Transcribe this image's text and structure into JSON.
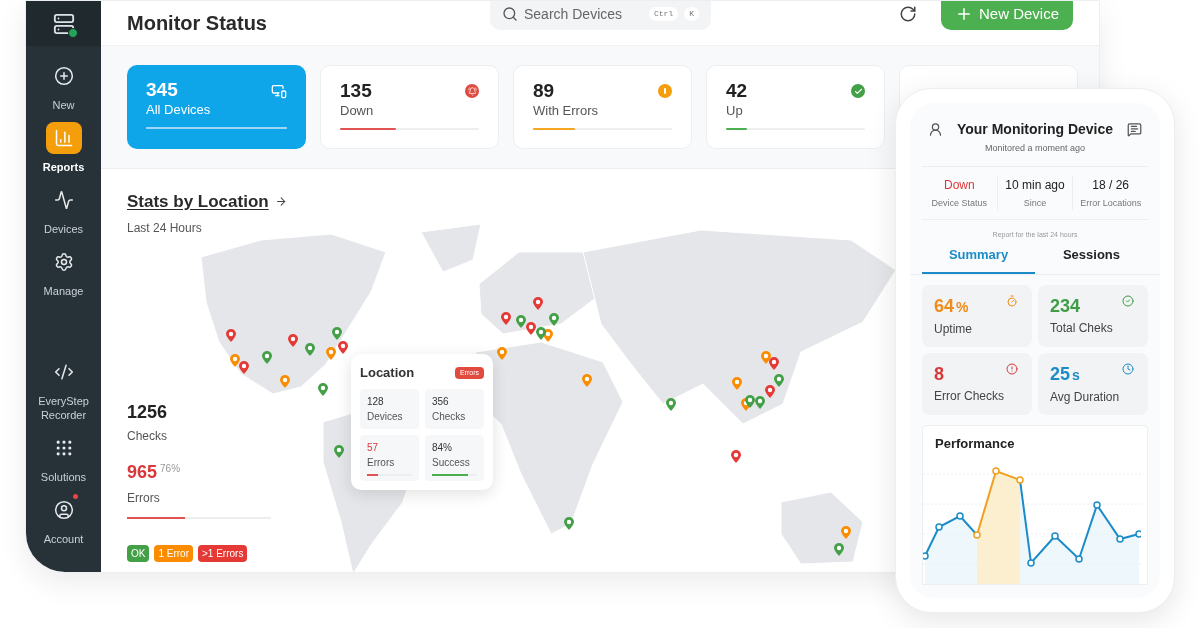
{
  "sidebar": {
    "items": [
      {
        "label": "New",
        "kind": "new",
        "selected": false,
        "notification": false
      },
      {
        "label": "Reports",
        "kind": "reports",
        "selected": true,
        "notification": false
      },
      {
        "label": "Devices",
        "kind": "devices",
        "selected": false,
        "notification": false
      },
      {
        "label": "Manage",
        "kind": "manage",
        "selected": false,
        "notification": false
      },
      {
        "label": "EveryStep Recorder",
        "kind": "recorder",
        "selected": false,
        "notification": false
      },
      {
        "label": "Solutions",
        "kind": "solutions",
        "selected": false,
        "notification": false
      },
      {
        "label": "Account",
        "kind": "account",
        "selected": false,
        "notification": true
      }
    ]
  },
  "header": {
    "title": "Monitor Status",
    "search": {
      "placeholder": "Search Devices",
      "shortcut": [
        "Ctrl",
        "K"
      ]
    },
    "new_button": "New Device"
  },
  "cards": [
    {
      "value": "345",
      "label": "All Devices",
      "kind": "all",
      "selected": true,
      "level": 1
    },
    {
      "value": "135",
      "label": "Down",
      "kind": "down",
      "selected": false,
      "level": 0.4
    },
    {
      "value": "89",
      "label": "With Errors",
      "kind": "errors",
      "selected": false,
      "level": 0.3
    },
    {
      "value": "42",
      "label": "Up",
      "kind": "up",
      "selected": false,
      "level": 0.15
    }
  ],
  "map": {
    "title": "Stats by Location",
    "subtitle": "Last 24 Hours",
    "checks": {
      "value": "1256",
      "label": "Checks"
    },
    "errors": {
      "value": "965",
      "percent": "76%",
      "label": "Errors",
      "level": 0.4
    },
    "legend": [
      {
        "label": "OK",
        "color": "#43a047"
      },
      {
        "label": "1 Error",
        "color": "#fb8c00"
      },
      {
        "label": ">1 Errors",
        "color": "#e53935"
      }
    ],
    "pins": [
      {
        "color": "#e53935"
      },
      {
        "color": "#fb8c00"
      },
      {
        "color": "#e53935"
      },
      {
        "color": "#43a047"
      },
      {
        "color": "#e53935"
      },
      {
        "color": "#43a047"
      },
      {
        "color": "#fb8c00"
      },
      {
        "color": "#43a047"
      },
      {
        "color": "#e53935"
      },
      {
        "color": "#fb8c00"
      },
      {
        "color": "#43a047"
      },
      {
        "color": "#43a047"
      },
      {
        "color": "#e53935"
      },
      {
        "color": "#e53935"
      },
      {
        "color": "#43a047"
      },
      {
        "color": "#e53935"
      },
      {
        "color": "#fb8c00"
      },
      {
        "color": "#43a047"
      },
      {
        "color": "#43a047"
      },
      {
        "color": "#fb8c00"
      },
      {
        "color": "#fb8c00"
      },
      {
        "color": "#43a047"
      },
      {
        "color": "#fb8c00"
      },
      {
        "color": "#e53935"
      },
      {
        "color": "#fb8c00"
      },
      {
        "color": "#43a047"
      },
      {
        "color": "#e53935"
      },
      {
        "color": "#fb8c00"
      },
      {
        "color": "#43a047"
      },
      {
        "color": "#43a047"
      },
      {
        "color": "#e53935"
      },
      {
        "color": "#43a047"
      },
      {
        "color": "#fb8c00"
      },
      {
        "color": "#43a047"
      }
    ],
    "popup": {
      "title": "Location",
      "badge": "Errors",
      "stats": [
        {
          "value": "128",
          "label": "Devices",
          "kind": "plain"
        },
        {
          "value": "356",
          "label": "Checks",
          "kind": "plain"
        },
        {
          "value": "57",
          "label": "Errors",
          "kind": "error",
          "level": 0.25
        },
        {
          "value": "84%",
          "label": "Success",
          "kind": "success",
          "level": 0.8
        }
      ]
    }
  },
  "phone": {
    "title": "Your Monitoring Device",
    "subtitle": "Monitored a moment ago",
    "status": [
      {
        "value": "Down",
        "label": "Device Status",
        "kind": "alert"
      },
      {
        "value": "10 min ago",
        "label": "Since",
        "kind": "plain"
      },
      {
        "value": "18 / 26",
        "label": "Error Locations",
        "kind": "plain"
      }
    ],
    "report_note": "Report for the last 24 hours",
    "tabs": [
      {
        "label": "Summary",
        "selected": true
      },
      {
        "label": "Sessions",
        "selected": false
      }
    ],
    "metrics": [
      {
        "value": "64",
        "unit": "%",
        "label": "Uptime",
        "kind": "uptime",
        "color": "#f08c1a"
      },
      {
        "value": "234",
        "label": "Total Cheks",
        "kind": "total",
        "color": "#3f9d45"
      },
      {
        "value": "8",
        "label": "Error Checks",
        "kind": "error",
        "color": "#d9383a"
      },
      {
        "value": "25",
        "unit": "s",
        "label": "Avg Duration",
        "kind": "duration",
        "color": "#1c8cc8"
      }
    ],
    "performance": {
      "title": "Performance"
    }
  }
}
